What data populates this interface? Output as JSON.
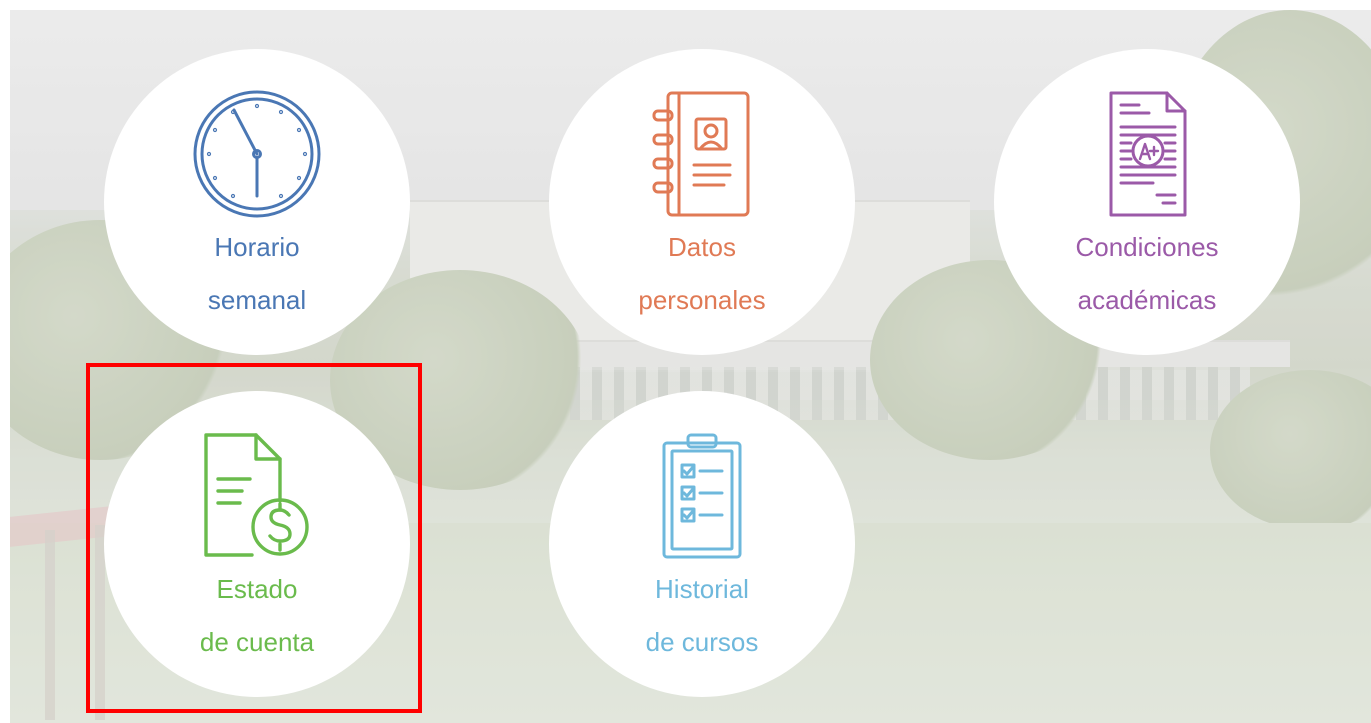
{
  "colors": {
    "horario": "#4a77b4",
    "datos": "#e07a55",
    "condiciones": "#9b5aa8",
    "estado": "#6abb4c",
    "historial": "#6eb8dc",
    "highlight": "#ff0000"
  },
  "tiles": [
    {
      "line1": "Horario",
      "line2": "semanal",
      "icon": "clock-icon"
    },
    {
      "line1": "Datos",
      "line2": "personales",
      "icon": "address-book-icon"
    },
    {
      "line1": "Condiciones",
      "line2": "académicas",
      "icon": "graded-document-icon"
    },
    {
      "line1": "Estado",
      "line2": "de cuenta",
      "icon": "invoice-dollar-icon"
    },
    {
      "line1": "Historial",
      "line2": "de cursos",
      "icon": "clipboard-checklist-icon"
    }
  ],
  "highlighted_tile": "Estado de cuenta"
}
